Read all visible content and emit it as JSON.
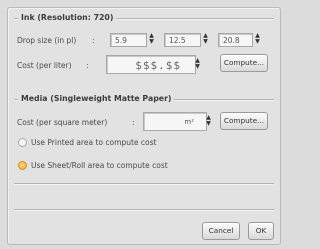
{
  "ink": {
    "title": "Ink (Resolution: 720)",
    "drop_size_label": "Drop size (in pl)",
    "drop_size_colon": ":",
    "drop_sizes": [
      "5.9",
      "12.5",
      "20.8"
    ],
    "cost_label": "Cost (per liter)",
    "cost_colon": ":",
    "cost_value": "$$$.$$",
    "compute_label": "Compute..."
  },
  "media": {
    "title": "Media (Singleweight Matte Paper)",
    "cost_label": "Cost (per square meter)",
    "cost_colon": ":",
    "cost_value": "m²",
    "compute_label": "Compute...",
    "options": [
      {
        "label": "Use Printed area to compute cost",
        "selected": false
      },
      {
        "label": "Use Sheet/Roll area to compute cost",
        "selected": true
      }
    ]
  },
  "footer": {
    "cancel_label": "Cancel",
    "ok_label": "OK"
  },
  "colors": {
    "radio_selected": "#f5a623",
    "background": "#dcdcdc"
  }
}
